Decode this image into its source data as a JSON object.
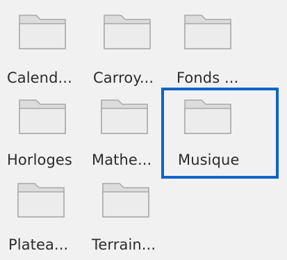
{
  "folders": [
    {
      "name": "Calend...",
      "icon": "folder-icon"
    },
    {
      "name": "Carroy...",
      "icon": "folder-icon"
    },
    {
      "name": "Fonds ...",
      "icon": "folder-icon"
    },
    {
      "name": "Horloges",
      "icon": "folder-icon"
    },
    {
      "name": "Mathe...",
      "icon": "folder-icon"
    },
    {
      "name": "Musique",
      "icon": "folder-icon",
      "selected": true
    },
    {
      "name": "Platea...",
      "icon": "folder-icon"
    },
    {
      "name": "Terrain...",
      "icon": "folder-icon"
    }
  ],
  "colors": {
    "background": "#f1f1f1",
    "selection_border": "#0b64c8",
    "folder_fill": "#e8e8e8",
    "folder_stroke": "#a8a8a8",
    "text": "#2c2c2c"
  }
}
